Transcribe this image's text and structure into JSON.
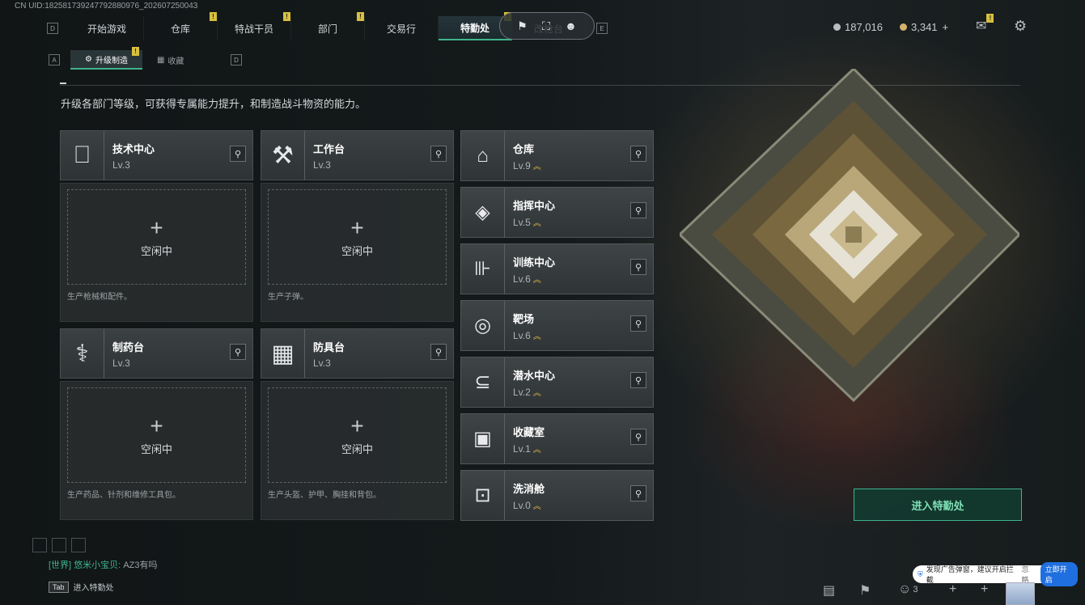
{
  "uid": "CN UID:18258173924779288097\u0000_202607250043",
  "nav": {
    "left_key": "D",
    "right_key": "E",
    "tabs": [
      {
        "label": "开始游戏",
        "alert": false,
        "active": false
      },
      {
        "label": "仓库",
        "alert": true,
        "active": false
      },
      {
        "label": "特战干员",
        "alert": true,
        "active": false
      },
      {
        "label": "部门",
        "alert": true,
        "active": false
      },
      {
        "label": "交易行",
        "alert": false,
        "active": false
      },
      {
        "label": "特勤处",
        "alert": true,
        "active": true
      },
      {
        "label": "改枪台",
        "alert": false,
        "active": false
      }
    ],
    "alert_mark": "!"
  },
  "toolbar_pill": {
    "icons": [
      "flag-icon",
      "scan-icon",
      "robot-icon"
    ]
  },
  "currency": {
    "silver": "187,016",
    "gold": "3,341",
    "gold_add": "+",
    "colors": {
      "silver": "#b9bec1",
      "gold": "#d6b36a"
    }
  },
  "subnav": {
    "left_key": "A",
    "right_key": "D",
    "tabs": [
      {
        "label": "升级制造",
        "active": true
      },
      {
        "label": "收藏",
        "active": false
      }
    ]
  },
  "description": "升级各部门等级，可获得专属能力提升，和制造战斗物资的能力。",
  "workshops": [
    {
      "name": "技术中心",
      "level": "Lv.3",
      "icon": "monitor-icon",
      "status": "空闲中",
      "plus": "+",
      "footer": "生产枪械和配件。"
    },
    {
      "name": "工作台",
      "level": "Lv.3",
      "icon": "tools-icon",
      "status": "空闲中",
      "plus": "+",
      "footer": "生产子弹。"
    },
    {
      "name": "制药台",
      "level": "Lv.3",
      "icon": "microscope-icon",
      "status": "空闲中",
      "plus": "+",
      "footer": "生产药品、针剂和维修工具包。"
    },
    {
      "name": "防具台",
      "level": "Lv.3",
      "icon": "cubes-icon",
      "status": "空闲中",
      "plus": "+",
      "footer": "生产头盔、护甲、胸挂和背包。"
    }
  ],
  "facilities": [
    {
      "name": "仓库",
      "level": "Lv.9",
      "icon": "garage-icon",
      "glyph": "⌂"
    },
    {
      "name": "指挥中心",
      "level": "Lv.5",
      "icon": "command-icon",
      "glyph": "◈"
    },
    {
      "name": "训练中心",
      "level": "Lv.6",
      "icon": "dumbbell-icon",
      "glyph": "⊪"
    },
    {
      "name": "靶场",
      "level": "Lv.6",
      "icon": "target-icon",
      "glyph": "◎"
    },
    {
      "name": "潜水中心",
      "level": "Lv.2",
      "icon": "diving-mask-icon",
      "glyph": "⊆"
    },
    {
      "name": "收藏室",
      "level": "Lv.1",
      "icon": "vault-icon",
      "glyph": "▣"
    },
    {
      "name": "洗消舱",
      "level": "Lv.0",
      "icon": "decon-pod-icon",
      "glyph": "⊡"
    }
  ],
  "upgrade_chevron": "︽",
  "enter_button": "进入特勤处",
  "chat": {
    "channel": "[世界]",
    "user": "悠米小宝贝:",
    "message": "AZ3有吗"
  },
  "tab_hint": {
    "key": "Tab",
    "label": "进入特勤处"
  },
  "notice": {
    "text": "发现广告弹窗，建议开启拦截",
    "ignore": "忽略",
    "open": "立即开启"
  },
  "bottom_bar": {
    "team_count": "3"
  },
  "accent_color": "#3fb48c"
}
